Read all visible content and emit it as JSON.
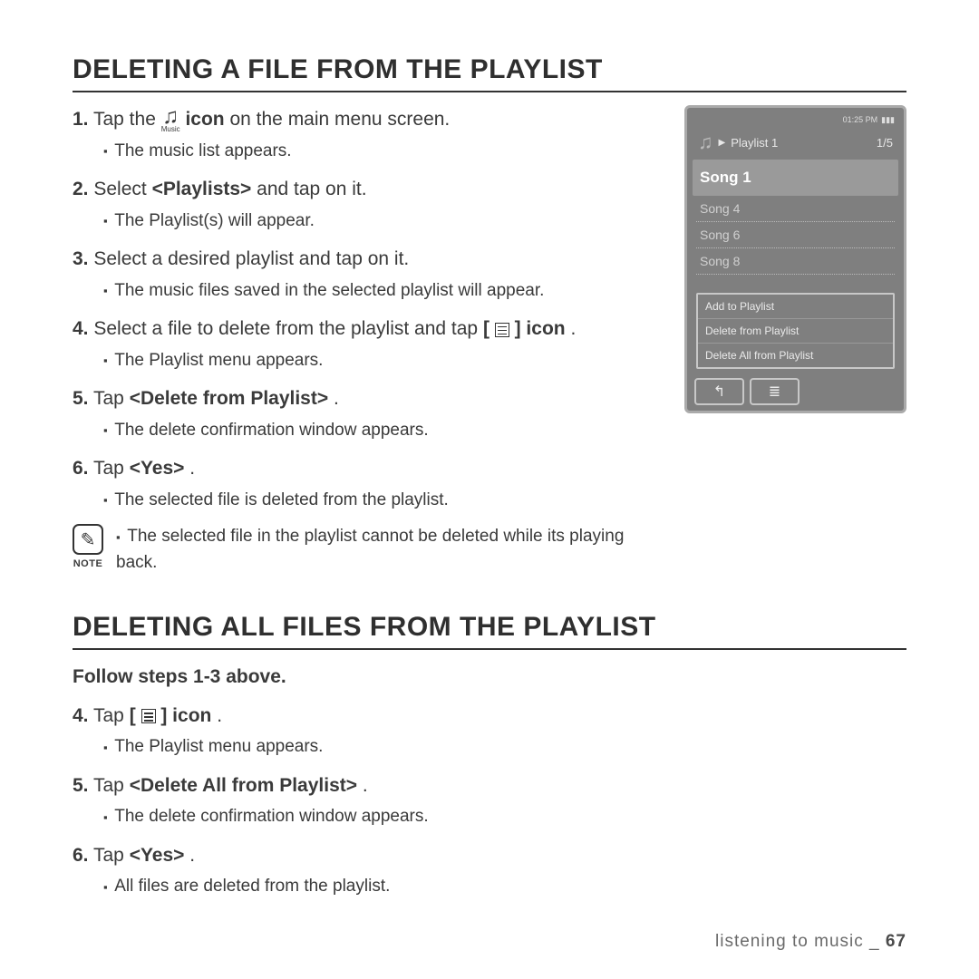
{
  "section1": {
    "title": "DELETING A FILE FROM THE PLAYLIST",
    "step1_a": "1.",
    "step1_b": "Tap the ",
    "step1_c": " icon",
    "step1_d": " on the main menu screen.",
    "music_label": "Music",
    "sub1": "The music list appears.",
    "step2_a": "2.",
    "step2_b": " Select ",
    "step2_c": "<Playlists>",
    "step2_d": " and tap on it.",
    "sub2": "The Playlist(s) will appear.",
    "step3_a": "3.",
    "step3_b": " Select a desired playlist and tap on it.",
    "sub3": "The music files saved in the selected playlist will appear.",
    "step4_a": "4.",
    "step4_b": " Select a file to delete from the playlist and tap ",
    "step4_c": "[ ",
    "step4_d": " ] icon",
    "step4_e": ".",
    "sub4": "The Playlist menu appears.",
    "step5_a": "5.",
    "step5_b": " Tap ",
    "step5_c": "<Delete from Playlist>",
    "step5_d": ".",
    "sub5": "The delete confirmation window appears.",
    "step6_a": "6.",
    "step6_b": " Tap ",
    "step6_c": "<Yes>",
    "step6_d": ".",
    "sub6": "The selected file is deleted from the playlist.",
    "note_label": "NOTE",
    "note_text": "The selected file in the playlist cannot be deleted while its playing back."
  },
  "section2": {
    "title": "DELETING ALL FILES FROM THE PLAYLIST",
    "follow": "Follow steps 1-3 above.",
    "step4_a": "4.",
    "step4_b": " Tap ",
    "step4_c": "[ ",
    "step4_d": " ] icon",
    "step4_e": ".",
    "sub4": "The Playlist menu appears.",
    "step5_a": "5.",
    "step5_b": " Tap ",
    "step5_c": "<Delete All from Playlist>",
    "step5_d": ".",
    "sub5": "The delete confirmation window appears.",
    "step6_a": "6.",
    "step6_b": " Tap ",
    "step6_c": "<Yes>",
    "step6_d": ".",
    "sub6": "All files are deleted from the playlist."
  },
  "device": {
    "time": "01:25 PM",
    "batt": "▮▮▮",
    "play": "▶",
    "playlist": "Playlist 1",
    "count": "1/5",
    "selected": "Song 1",
    "song2": "Song 4",
    "song3": "Song 6",
    "song4": "Song 8",
    "menu1": "Add to Playlist",
    "menu2": "Delete from Playlist",
    "menu3": "Delete All from Playlist",
    "back": "↰",
    "list": "≣"
  },
  "footer": {
    "text": "listening to music _ ",
    "page": "67"
  }
}
